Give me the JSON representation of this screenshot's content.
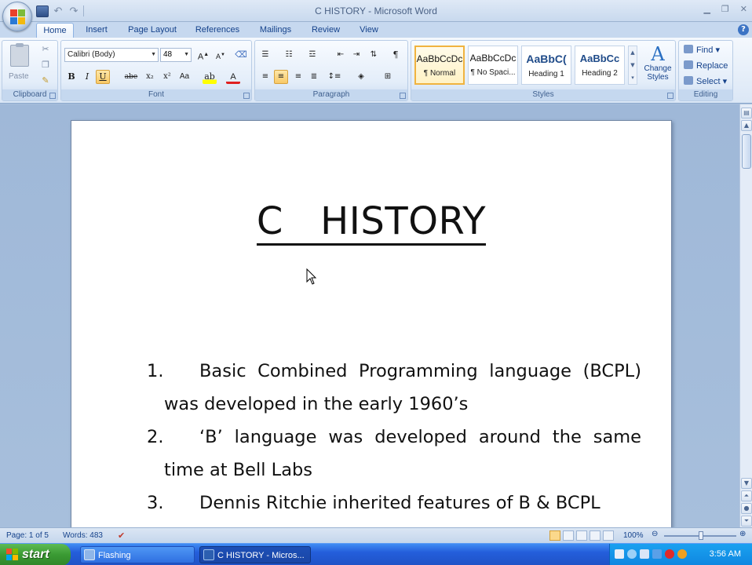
{
  "window": {
    "title": "C   HISTORY - Microsoft Word"
  },
  "tabs": [
    "Home",
    "Insert",
    "Page Layout",
    "References",
    "Mailings",
    "Review",
    "View"
  ],
  "ribbon": {
    "clipboard": {
      "label": "Clipboard",
      "paste": "Paste"
    },
    "font": {
      "label": "Font",
      "name": "Calibri (Body)",
      "size": "48"
    },
    "paragraph": {
      "label": "Paragraph"
    },
    "styles": {
      "label": "Styles",
      "tiles": [
        {
          "sample": "AaBbCcDc",
          "name": "¶ Normal"
        },
        {
          "sample": "AaBbCcDc",
          "name": "¶ No Spaci..."
        },
        {
          "sample": "AaBbC(",
          "name": "Heading 1"
        },
        {
          "sample": "AaBbCc",
          "name": "Heading 2"
        }
      ],
      "change_styles": "Change Styles"
    },
    "editing": {
      "label": "Editing",
      "find": "Find",
      "replace": "Replace",
      "select": "Select"
    }
  },
  "document": {
    "title": "C   HISTORY",
    "items": [
      {
        "num": "1.",
        "text": "Basic Combined Programming language (BCPL) was developed  in the early 1960’s"
      },
      {
        "num": "2.",
        "text": "‘B’ language was developed  around the same time at Bell Labs"
      },
      {
        "num": "3.",
        "text": "Dennis Ritchie inherited features of B & BCPL"
      }
    ]
  },
  "status": {
    "page": "Page: 1 of 5",
    "words": "Words: 483",
    "zoom": "100%"
  },
  "taskbar": {
    "start": "start",
    "tasks": [
      "Flashing",
      "C   HISTORY - Micros..."
    ],
    "clock": "3:56 AM"
  },
  "colors": {
    "ribbon_blue": "#15428b",
    "taskbar_blue": "#245edb",
    "start_green": "#3a9a33"
  }
}
